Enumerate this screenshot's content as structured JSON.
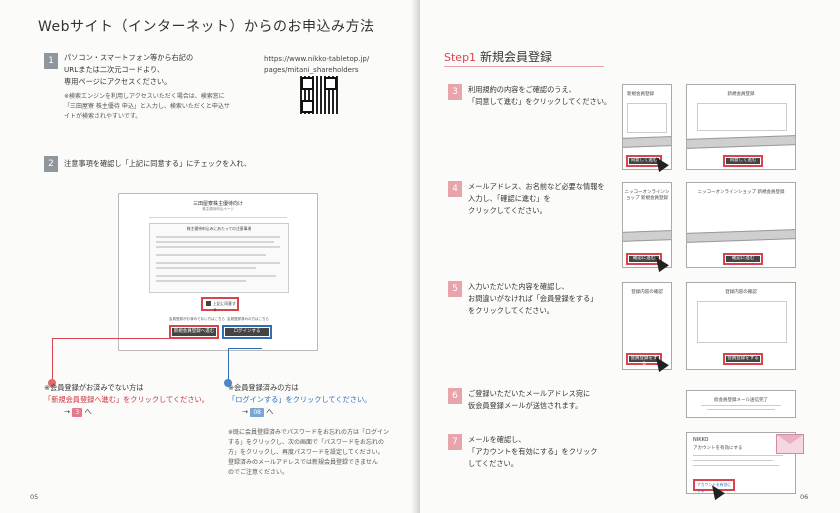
{
  "left": {
    "title": "Webサイト（インターネット）からのお申込み方法",
    "step1": {
      "num": "1",
      "lines": [
        "パソコン・スマートフォン等から右記の",
        "URLまたは二次元コードより、",
        "専用ページにアクセスください。"
      ],
      "note": [
        "※検索エンジンを利用しアクセスいただく場合は、検索窓に",
        "「三田屋寮 株主優待 申込」と入力し、検索いただくと申込サ",
        "イトが検索されやすいです。"
      ]
    },
    "url": [
      "https://www.nikko-tabletop.jp/",
      "pages/mitani_shareholders"
    ],
    "step2": {
      "num": "2",
      "text": "注意事項を確認し「上記に同意する」にチェックを入れ、"
    },
    "mock": {
      "title": "三田屋寮株主優待向け",
      "sub": "株主優待申込ページ",
      "section": "株主優待申込みにあたっての注意事項",
      "agree": "上記に同意する",
      "label_new": "会員登録がお済みでない方はこちら",
      "label_login": "会員登録済みの方はこちら",
      "btn_new": "新規会員登録へ進む",
      "btn_login": "ログインする"
    },
    "note_new": {
      "lines": [
        "※会員登録がお済みでない方は",
        "「新規会員登録へ進む」をクリックしてください。"
      ],
      "arrow": "→",
      "ref": "3",
      "suffix": "へ"
    },
    "note_login": {
      "lines": [
        "※会員登録済みの方は",
        "「ログインする」をクリックしてください。"
      ],
      "arrow": "→",
      "ref": "08",
      "suffix": "へ"
    },
    "note_pw": [
      "※既に会員登録済みでパスワードをお忘れの方は「ログイン",
      "する」をクリックし、次の画面で「パスワードをお忘れの",
      "方」をクリックし、再度パスワードを設定してください。",
      "登録済みのメールアドレスでは新規会員登録できません",
      "のでご注意ください。"
    ],
    "page": "05"
  },
  "right": {
    "step_label": "Step1",
    "step_title": "新規会員登録",
    "steps": [
      {
        "num": "3",
        "lines": [
          "利用規約の内容をご確認のうえ、",
          "「同意して進む」をクリックしてください。"
        ]
      },
      {
        "num": "4",
        "lines": [
          "メールアドレス、お名前など必要な情報を",
          "入力し、「確認に進む」を",
          "クリックしてください。"
        ]
      },
      {
        "num": "5",
        "lines": [
          "入力いただいた内容を確認し、",
          "お間違いがなければ「会員登録をする」",
          "をクリックしてください。"
        ]
      },
      {
        "num": "6",
        "lines": [
          "ご登録いただいたメールアドレス宛に",
          "仮会員登録メールが送信されます。"
        ]
      },
      {
        "num": "7",
        "lines": [
          "メールを確認し、",
          "「アカウントを有効にする」をクリック",
          "してください。"
        ]
      }
    ],
    "shots": {
      "s3_title": "新規会員登録",
      "s3_btn": "同意して進む",
      "s4_title": "ニッコーオンラインショップ 新規会員登録",
      "s4_btn": "確認に進む",
      "s5_title": "登録内容の確認",
      "s5_btn": "会員登録をする",
      "s6_title": "仮会員登録メール送信完了",
      "s7_brand": "NIKKO",
      "s7_head": "アカウントを有効にする",
      "s7_btn": "アカウントを有効にする"
    },
    "page": "06"
  }
}
